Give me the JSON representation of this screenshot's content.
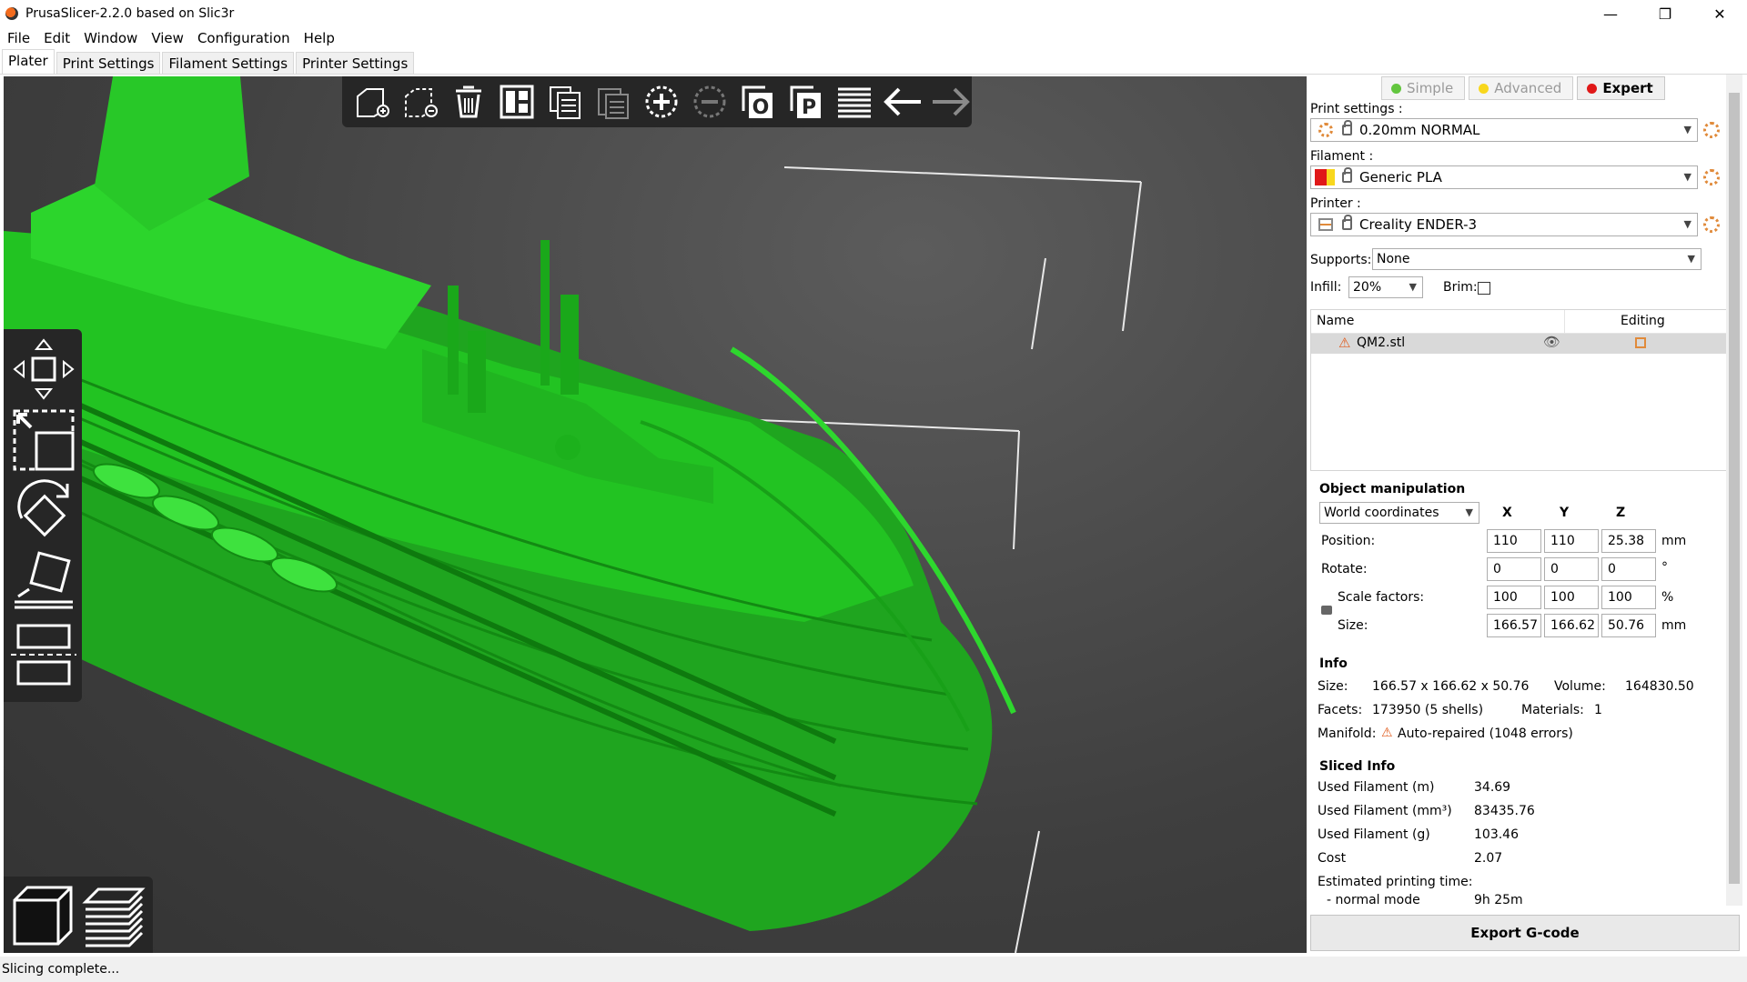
{
  "window": {
    "title": "PrusaSlicer-2.2.0 based on Slic3r",
    "minimize": "—",
    "restore": "❐",
    "close": "✕"
  },
  "menu": [
    "File",
    "Edit",
    "Window",
    "View",
    "Configuration",
    "Help"
  ],
  "tabs": [
    "Plater",
    "Print Settings",
    "Filament Settings",
    "Printer Settings"
  ],
  "modes": {
    "simple": "Simple",
    "advanced": "Advanced",
    "expert": "Expert",
    "colors": {
      "simple": "#63c63f",
      "advanced": "#f8d71d",
      "expert": "#e01818"
    }
  },
  "presets": {
    "print_label": "Print settings :",
    "print_value": "0.20mm NORMAL",
    "filament_label": "Filament :",
    "filament_value": "Generic PLA",
    "printer_label": "Printer :",
    "printer_value": "Creality ENDER-3",
    "supports_label": "Supports:",
    "supports_value": "None",
    "infill_label": "Infill:",
    "infill_value": "20%",
    "brim_label": "Brim:"
  },
  "object_list": {
    "col_name": "Name",
    "col_editing": "Editing",
    "items": [
      {
        "name": "QM2.stl"
      }
    ]
  },
  "manipulation": {
    "title": "Object manipulation",
    "coord_system": "World coordinates",
    "axes": [
      "X",
      "Y",
      "Z"
    ],
    "rows": [
      {
        "label": "Position:",
        "x": "110",
        "y": "110",
        "z": "25.38",
        "unit": "mm"
      },
      {
        "label": "Rotate:",
        "x": "0",
        "y": "0",
        "z": "0",
        "unit": "°"
      },
      {
        "label": "Scale factors:",
        "x": "100",
        "y": "100",
        "z": "100",
        "unit": "%"
      },
      {
        "label": "Size:",
        "x": "166.57",
        "y": "166.62",
        "z": "50.76",
        "unit": "mm"
      }
    ]
  },
  "info": {
    "title": "Info",
    "size_label": "Size:",
    "size_value": "166.57 x 166.62 x 50.76",
    "volume_label": "Volume:",
    "volume_value": "164830.50",
    "facets_label": "Facets:",
    "facets_value": "173950 (5 shells)",
    "materials_label": "Materials:",
    "materials_value": "1",
    "manifold_label": "Manifold:",
    "manifold_value": "Auto-repaired (1048 errors)"
  },
  "sliced_info": {
    "title": "Sliced Info",
    "rows": [
      {
        "label": "Used Filament (m)",
        "value": "34.69"
      },
      {
        "label": "Used Filament (mm³)",
        "value": "83435.76"
      },
      {
        "label": "Used Filament (g)",
        "value": "103.46"
      },
      {
        "label": "Cost",
        "value": "2.07"
      }
    ],
    "time_label": "Estimated printing time:",
    "mode_label": "- normal mode",
    "mode_value": "9h 25m"
  },
  "export_button": "Export G-code",
  "status": "Slicing complete..."
}
